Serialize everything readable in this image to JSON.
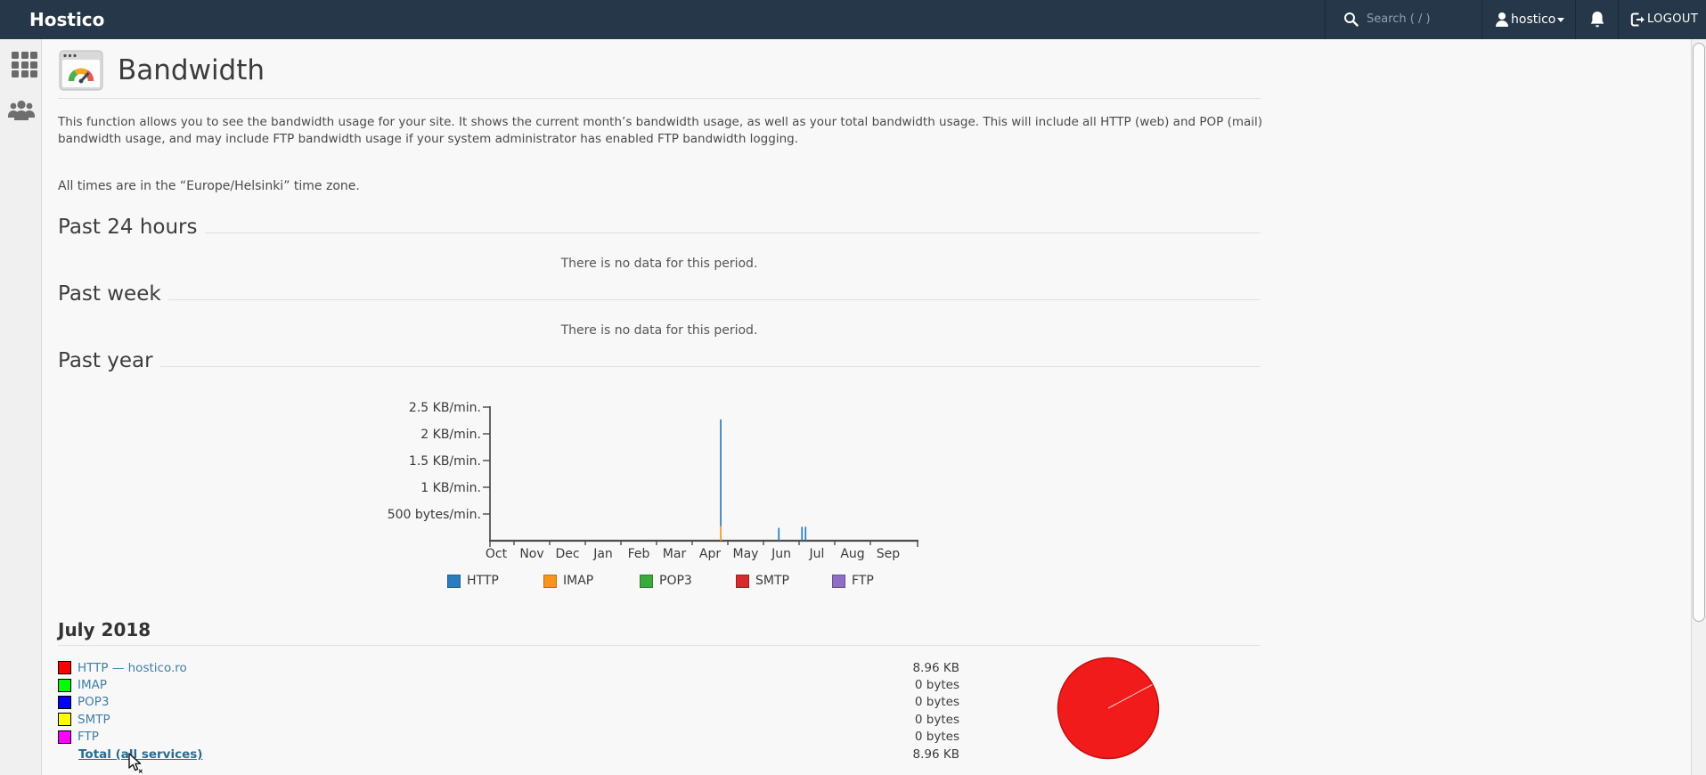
{
  "header": {
    "brand": "Hostico",
    "search_placeholder": "Search ( / )",
    "user": "hostico",
    "logout_label": "LOGOUT",
    "bar_color": "#253748"
  },
  "sidebar": {
    "icons": [
      "app-grid",
      "users"
    ]
  },
  "page": {
    "title": "Bandwidth",
    "description": "This function allows you to see the bandwidth usage for your site. It shows the current month’s bandwidth usage, as well as your total bandwidth usage. This will include all HTTP (web) and POP (mail) bandwidth usage, and may include FTP bandwidth usage if your system administrator has enabled FTP bandwidth logging.",
    "timezone_note": "All times are in the “Europe/Helsinki” time zone."
  },
  "sections": {
    "past24": {
      "title": "Past 24 hours",
      "empty": "There is no data for this period."
    },
    "pastweek": {
      "title": "Past week",
      "empty": "There is no data for this period."
    },
    "pastyear": {
      "title": "Past year"
    }
  },
  "chart_data": [
    {
      "type": "bar",
      "title": "Past year",
      "categories": [
        "Oct",
        "Nov",
        "Dec",
        "Jan",
        "Feb",
        "Mar",
        "Apr",
        "May",
        "Jun",
        "Jul",
        "Aug",
        "Sep"
      ],
      "y_tick_labels": [
        "2.5 KB/min.",
        "2 KB/min.",
        "1.5 KB/min.",
        "1 KB/min.",
        "500 bytes/min."
      ],
      "ylabel": "KB/min.",
      "ylim": [
        0,
        2.5
      ],
      "grid": false,
      "legend_position": "bottom",
      "series": [
        {
          "name": "HTTP",
          "color": "#2b7cbd",
          "points": [
            {
              "pos": 6.3,
              "from": 0.27,
              "to": 2.27
            },
            {
              "pos": 7.93,
              "from": 0,
              "to": 0.24
            },
            {
              "pos": 8.58,
              "from": 0,
              "to": 0.26
            },
            {
              "pos": 8.68,
              "from": 0,
              "to": 0.26
            }
          ]
        },
        {
          "name": "IMAP",
          "color": "#f7941d",
          "points": [
            {
              "pos": 6.3,
              "from": 0,
              "to": 0.27
            }
          ]
        }
      ]
    },
    {
      "type": "pie",
      "title": "July 2018",
      "slices": [
        {
          "label": "HTTP — hostico.ro",
          "value": "8.96 KB",
          "pct": 100,
          "color": "#f21b1b"
        },
        {
          "label": "IMAP",
          "value": "0 bytes",
          "pct": 0,
          "color": "#00ff00"
        },
        {
          "label": "POP3",
          "value": "0 bytes",
          "pct": 0,
          "color": "#0000ff"
        },
        {
          "label": "SMTP",
          "value": "0 bytes",
          "pct": 0,
          "color": "#ffff00"
        },
        {
          "label": "FTP",
          "value": "0 bytes",
          "pct": 0,
          "color": "#ff00ff"
        }
      ],
      "border_color": "#c11010",
      "radius_line_color": "#ffc9c9"
    }
  ],
  "legend": [
    {
      "label": "HTTP",
      "color": "#2b7cbd",
      "border": "#1d5f96"
    },
    {
      "label": "IMAP",
      "color": "#f7941d",
      "border": "#c1700d"
    },
    {
      "label": "POP3",
      "color": "#3aaa3c",
      "border": "#2b7e2c"
    },
    {
      "label": "SMTP",
      "color": "#d62b2b",
      "border": "#a31d1d"
    },
    {
      "label": "FTP",
      "color": "#8f6fc4",
      "border": "#684d99"
    }
  ],
  "july": {
    "title": "July 2018",
    "rows": [
      {
        "label": "HTTP — hostico.ro",
        "swatch": "#ff0000",
        "value": "8.96 KB"
      },
      {
        "label": "IMAP",
        "swatch": "#00ff00",
        "value": "0 bytes"
      },
      {
        "label": "POP3",
        "swatch": "#0000ff",
        "value": "0 bytes"
      },
      {
        "label": "SMTP",
        "swatch": "#ffff00",
        "value": "0 bytes"
      },
      {
        "label": "FTP",
        "swatch": "#ff00ff",
        "value": "0 bytes"
      }
    ],
    "total": {
      "label": "Total (all services)",
      "value": "8.96 KB"
    }
  }
}
